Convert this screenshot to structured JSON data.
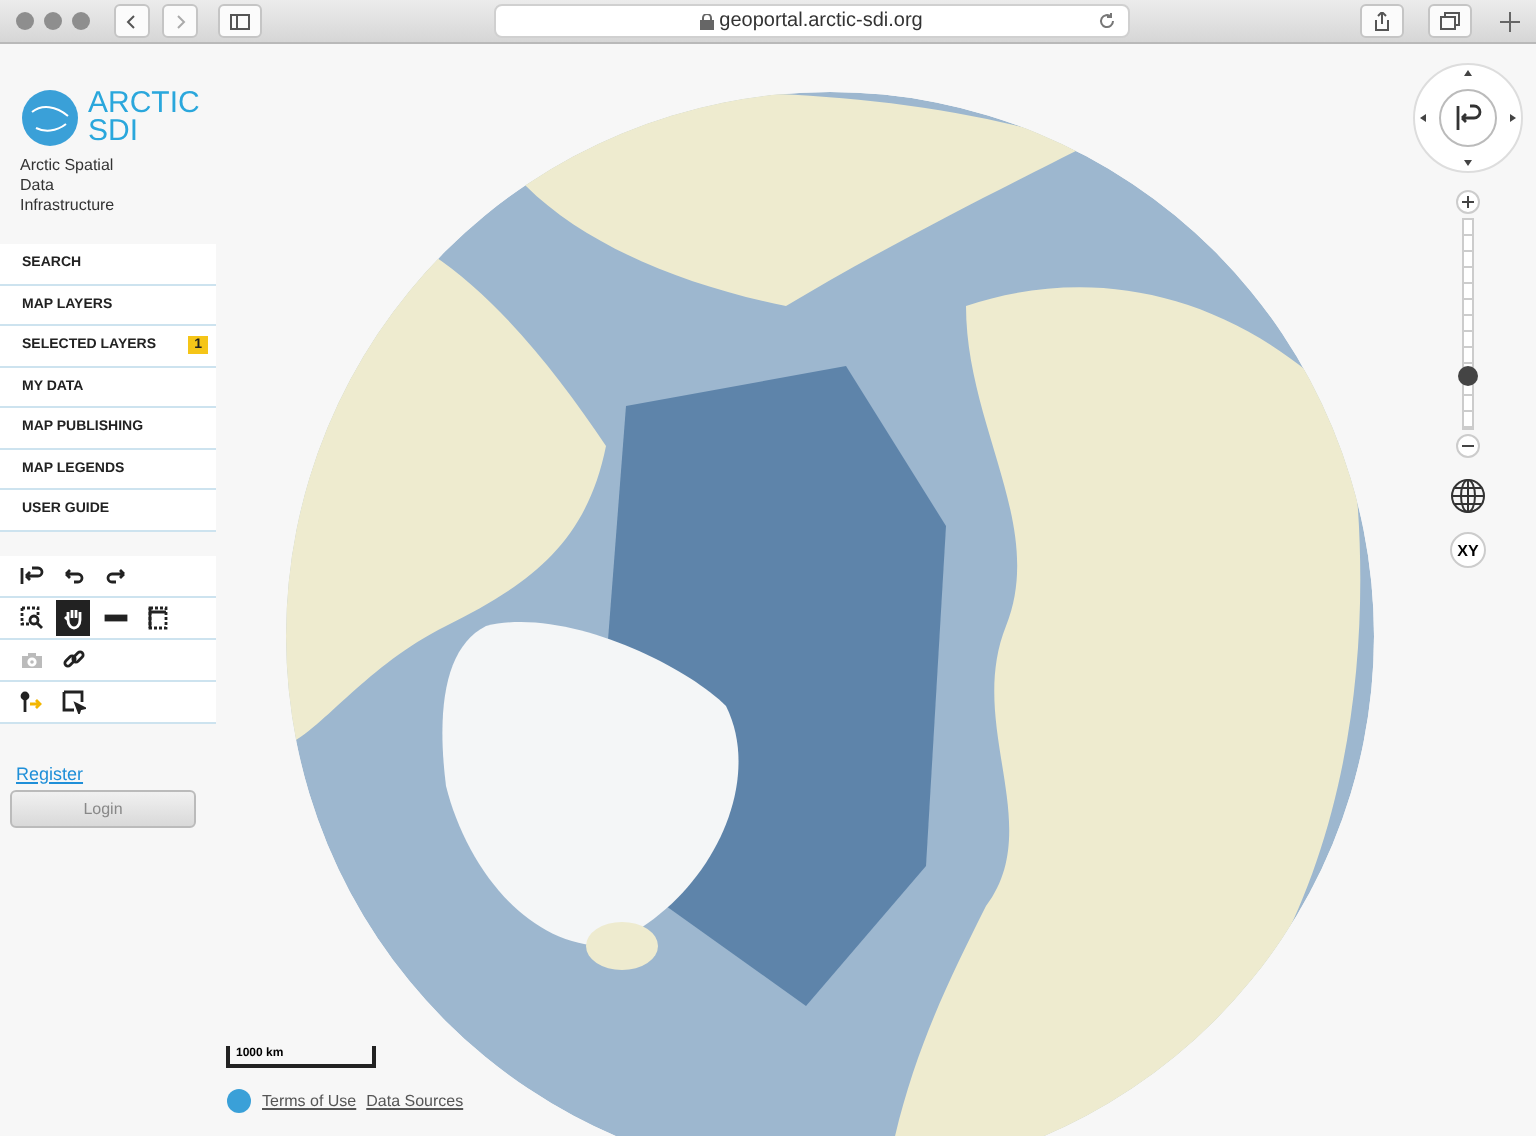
{
  "browser": {
    "url": "geoportal.arctic-sdi.org"
  },
  "logo": {
    "title": "ARCTIC",
    "title_line2": "SDI",
    "subtitle": "Arctic Spatial Data Infrastructure"
  },
  "menu": [
    {
      "label": "SEARCH"
    },
    {
      "label": "MAP LAYERS"
    },
    {
      "label": "SELECTED LAYERS",
      "badge": "1"
    },
    {
      "label": "MY DATA"
    },
    {
      "label": "MAP PUBLISHING"
    },
    {
      "label": "MAP LEGENDS"
    },
    {
      "label": "USER GUIDE"
    }
  ],
  "tool_rows": [
    [
      {
        "kind": "home",
        "selected": false,
        "disabled": false
      },
      {
        "kind": "undo",
        "selected": false,
        "disabled": false
      },
      {
        "kind": "redo",
        "selected": false,
        "disabled": false
      }
    ],
    [
      {
        "kind": "zoombox",
        "selected": false,
        "disabled": false
      },
      {
        "kind": "pan",
        "selected": true,
        "disabled": false
      },
      {
        "kind": "measure",
        "selected": false,
        "disabled": false
      },
      {
        "kind": "area",
        "selected": false,
        "disabled": false
      }
    ],
    [
      {
        "kind": "camera",
        "selected": false,
        "disabled": true
      },
      {
        "kind": "link",
        "selected": false,
        "disabled": false
      }
    ],
    [
      {
        "kind": "pin",
        "selected": false,
        "disabled": false
      },
      {
        "kind": "select",
        "selected": false,
        "disabled": false
      }
    ]
  ],
  "register": "Register",
  "login": {
    "label": "Login",
    "disabled": true
  },
  "zoom": {
    "level": 0.25
  },
  "coords_button": "XY",
  "scale": "1000 km",
  "footer": [
    "Terms of Use",
    "Data Sources"
  ]
}
